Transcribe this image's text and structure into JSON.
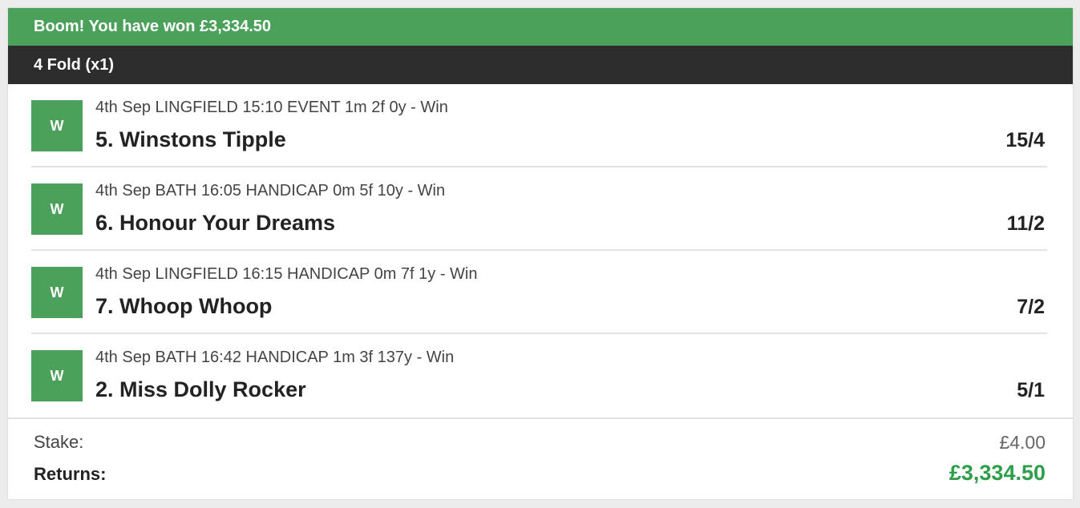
{
  "banner": {
    "text": "Boom! You have won £3,334.50"
  },
  "bet_type": {
    "label": "4 Fold (x1)"
  },
  "selections": [
    {
      "result": "W",
      "event": "4th Sep LINGFIELD 15:10 EVENT 1m 2f 0y - Win",
      "runner": "5. Winstons Tipple",
      "odds": "15/4"
    },
    {
      "result": "W",
      "event": "4th Sep BATH 16:05 HANDICAP 0m 5f 10y - Win",
      "runner": "6. Honour Your Dreams",
      "odds": "11/2"
    },
    {
      "result": "W",
      "event": "4th Sep LINGFIELD 16:15 HANDICAP 0m 7f 1y - Win",
      "runner": "7. Whoop Whoop",
      "odds": "7/2"
    },
    {
      "result": "W",
      "event": "4th Sep BATH 16:42 HANDICAP 1m 3f 137y - Win",
      "runner": "2. Miss Dolly Rocker",
      "odds": "5/1"
    }
  ],
  "summary": {
    "stake_label": "Stake:",
    "stake_value": "£4.00",
    "returns_label": "Returns:",
    "returns_value": "£3,334.50"
  },
  "colors": {
    "win_green": "#4ca15a",
    "header_dark": "#2d2d2d",
    "returns_green": "#2e9e4a"
  }
}
